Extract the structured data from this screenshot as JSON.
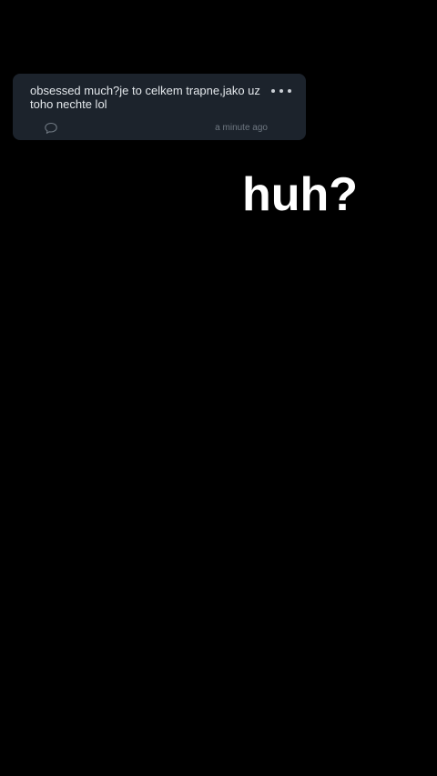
{
  "comment": {
    "text": "obsessed much?je to celkem trapne,jako uz toho nechte lol",
    "timestamp": "a minute ago",
    "more_icon": "more-horizontal-icon",
    "reply_icon": "speech-bubble-icon"
  },
  "caption": {
    "text": "huh?"
  },
  "colors": {
    "background": "#000000",
    "card": "#1c232c",
    "card_text": "#e4e8ec",
    "muted_text": "#6f7882",
    "caption": "#ffffff"
  }
}
